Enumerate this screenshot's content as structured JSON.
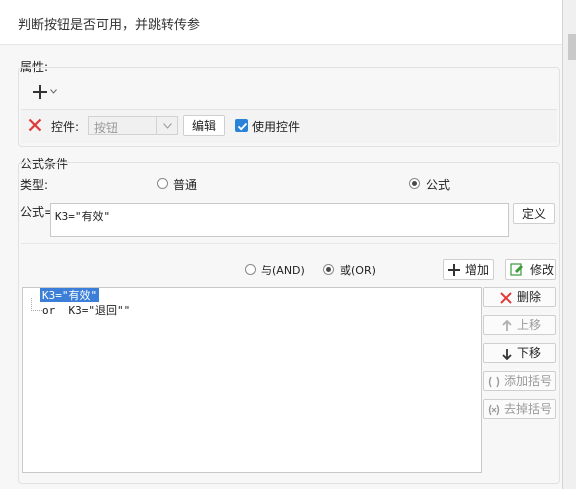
{
  "dialog": {
    "title": "判断按钮是否可用，并跳转传参"
  },
  "properties": {
    "label": "属性:",
    "control_label": "控件:",
    "control_select": {
      "value": "按钮"
    },
    "edit_button": "编辑",
    "use_control": {
      "label": "使用控件",
      "checked": true
    }
  },
  "formula": {
    "group_label": "公式条件",
    "type_label": "类型:",
    "type_options": [
      {
        "label": "普通",
        "selected": false
      },
      {
        "label": "公式",
        "selected": true
      }
    ],
    "formula_label": "公式=",
    "formula_value": "K3=\"有效\"",
    "define_button": "定义",
    "logic_options": [
      {
        "label": "与(AND)",
        "selected": false
      },
      {
        "label": "或(OR)",
        "selected": true
      }
    ],
    "add_button": "增加",
    "modify_button": "修改",
    "conditions": [
      {
        "text": "K3=\"有效\"",
        "selected": true
      },
      {
        "text": "or  K3=\"退回\"\"",
        "selected": false
      }
    ],
    "side_buttons": {
      "delete": "删除",
      "move_up": "上移",
      "move_down": "下移",
      "add_parens": "添加括号",
      "remove_parens": "去掉括号"
    }
  },
  "colors": {
    "accent": "#2b82d9",
    "delete_red": "#e03a3a",
    "selection": "#3b7fd9"
  }
}
